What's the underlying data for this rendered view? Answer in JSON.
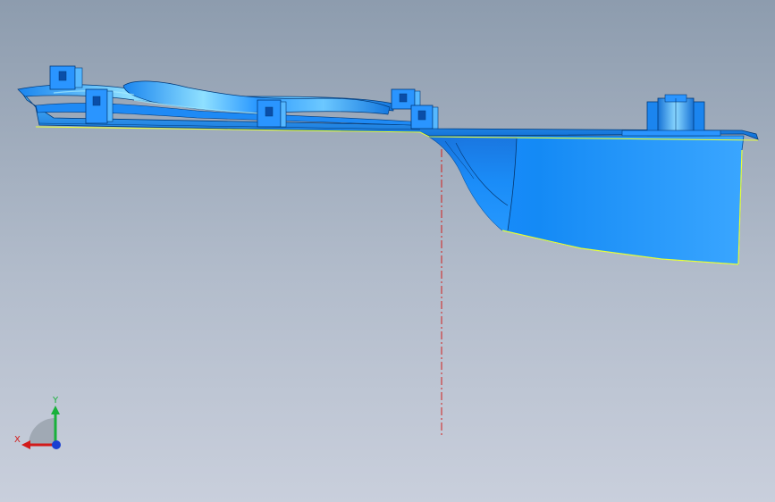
{
  "viewport": {
    "background_top": "#8d9cae",
    "background_bottom": "#c9cfdc"
  },
  "model": {
    "part_color": "#1f8fff",
    "part_dark": "#0b5fc9",
    "part_light": "#7fd0ff",
    "edge_color": "#003a7a",
    "highlight_edge": "#e7ff3a",
    "centerline_color": "#d2201d"
  },
  "triad": {
    "x_label": "X",
    "y_label": "Y",
    "x_color": "#d21a1a",
    "y_color": "#18b13a",
    "z_color": "#1a3fd2",
    "icon": "coordinate-triad-icon"
  }
}
